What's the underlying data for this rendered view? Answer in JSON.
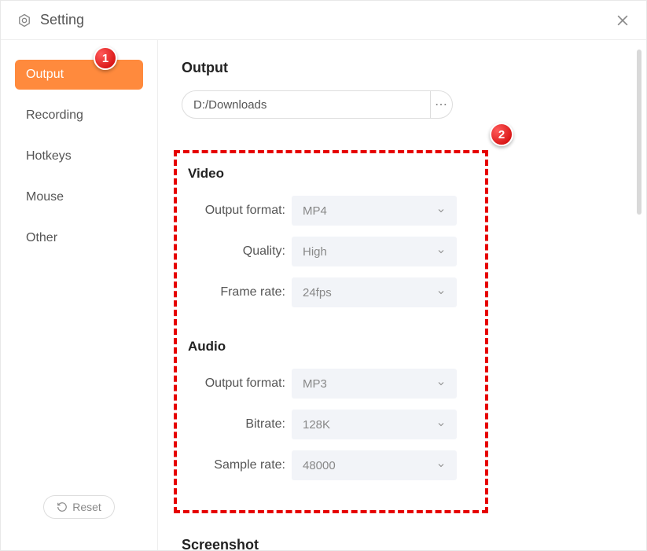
{
  "header": {
    "title": "Setting"
  },
  "sidebar": {
    "items": [
      {
        "label": "Output",
        "active": true
      },
      {
        "label": "Recording",
        "active": false
      },
      {
        "label": "Hotkeys",
        "active": false
      },
      {
        "label": "Mouse",
        "active": false
      },
      {
        "label": "Other",
        "active": false
      }
    ],
    "reset_label": "Reset"
  },
  "content": {
    "output_section_title": "Output",
    "output_path": "D:/Downloads",
    "video": {
      "title": "Video",
      "output_format_label": "Output format:",
      "output_format_value": "MP4",
      "quality_label": "Quality:",
      "quality_value": "High",
      "frame_rate_label": "Frame rate:",
      "frame_rate_value": "24fps"
    },
    "audio": {
      "title": "Audio",
      "output_format_label": "Output format:",
      "output_format_value": "MP3",
      "bitrate_label": "Bitrate:",
      "bitrate_value": "128K",
      "sample_rate_label": "Sample rate:",
      "sample_rate_value": "48000"
    },
    "screenshot_section_title": "Screenshot"
  },
  "annotations": {
    "badge1": "1",
    "badge2": "2"
  }
}
